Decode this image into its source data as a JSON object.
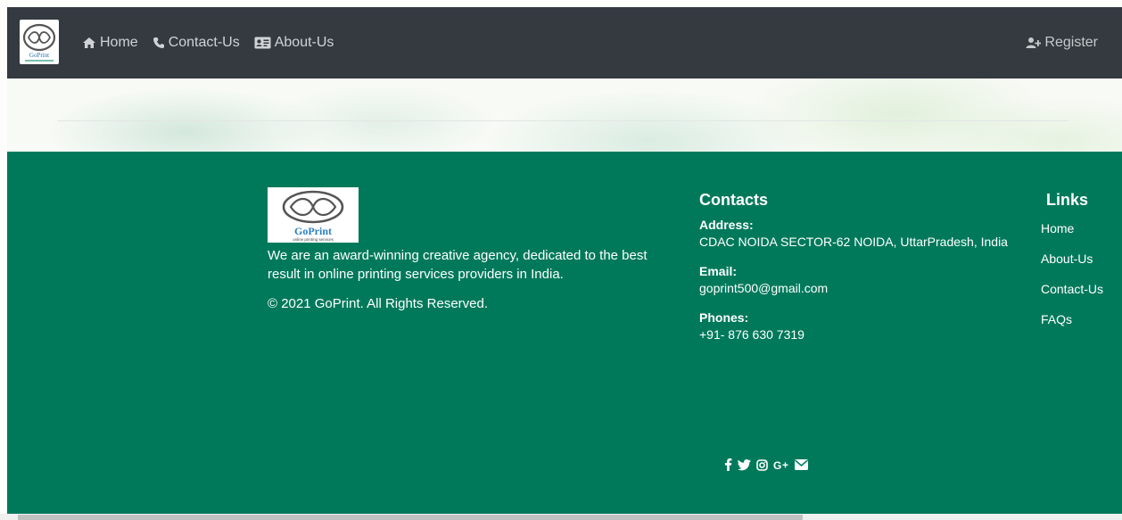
{
  "brand": {
    "name": "GoPrint",
    "logo_text": "GoPrint",
    "logo_tagline": "online printing services"
  },
  "navbar": {
    "items": [
      {
        "label": "Home",
        "icon": "home-icon"
      },
      {
        "label": "Contact-Us",
        "icon": "phone-icon"
      },
      {
        "label": "About-Us",
        "icon": "id-card-icon"
      }
    ],
    "register_label": "Register",
    "register_icon": "user-plus-icon"
  },
  "footer": {
    "about_text": "We are an award-winning creative agency, dedicated to the best result in online printing services providers in India.",
    "copyright": "©  2021 GoPrint. All Rights Reserved.",
    "contacts": {
      "heading": "Contacts",
      "address_label": "Address:",
      "address_value": "CDAC NOIDA SECTOR-62 NOIDA, UttarPradesh, India",
      "email_label": "Email:",
      "email_value": "goprint500@gmail.com",
      "phones_label": "Phones:",
      "phones_value": "+91- 876 630 7319"
    },
    "links": {
      "heading": "Links",
      "items": [
        "Home",
        "About-Us",
        "Contact-Us",
        "FAQs"
      ]
    },
    "social": [
      "facebook-icon",
      "twitter-icon",
      "instagram-icon",
      "google-plus-icon",
      "envelope-icon"
    ]
  },
  "colors": {
    "navbar": "#343a40",
    "footer": "#00795b",
    "nav_text": "#d0d3d6"
  }
}
